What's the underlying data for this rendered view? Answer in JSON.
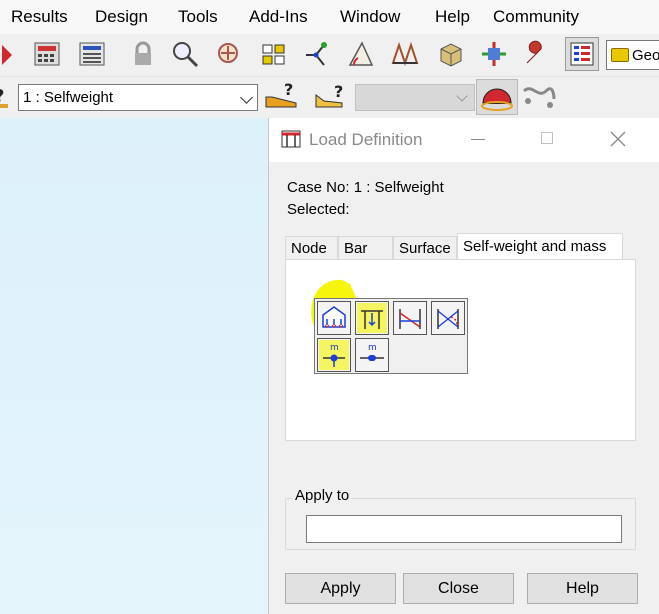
{
  "menubar": {
    "items": [
      "Results",
      "Design",
      "Tools",
      "Add-Ins",
      "Window",
      "Help",
      "Community"
    ]
  },
  "toolbar2": {
    "load_case": "1 : Selfweight"
  },
  "geometry_box": {
    "label": "Geo"
  },
  "dialog": {
    "title": "Load Definition",
    "case_no_label": "Case No:",
    "case_no_value": "1 : Selfweight",
    "selected_label": "Selected:",
    "tabs": [
      "Node",
      "Bar",
      "Surface",
      "Self-weight and mass"
    ],
    "active_tab": "Self-weight and mass",
    "apply_to_label": "Apply to",
    "apply_to_value": "",
    "buttons": {
      "apply": "Apply",
      "close": "Close",
      "help": "Help"
    },
    "grid_buttons_row2_label": "m"
  },
  "colors": {
    "highlight": "#f5f500",
    "workspace": "#dff2fb",
    "accent_blue": "#1a3fd6",
    "accent_red": "#d0282e"
  }
}
